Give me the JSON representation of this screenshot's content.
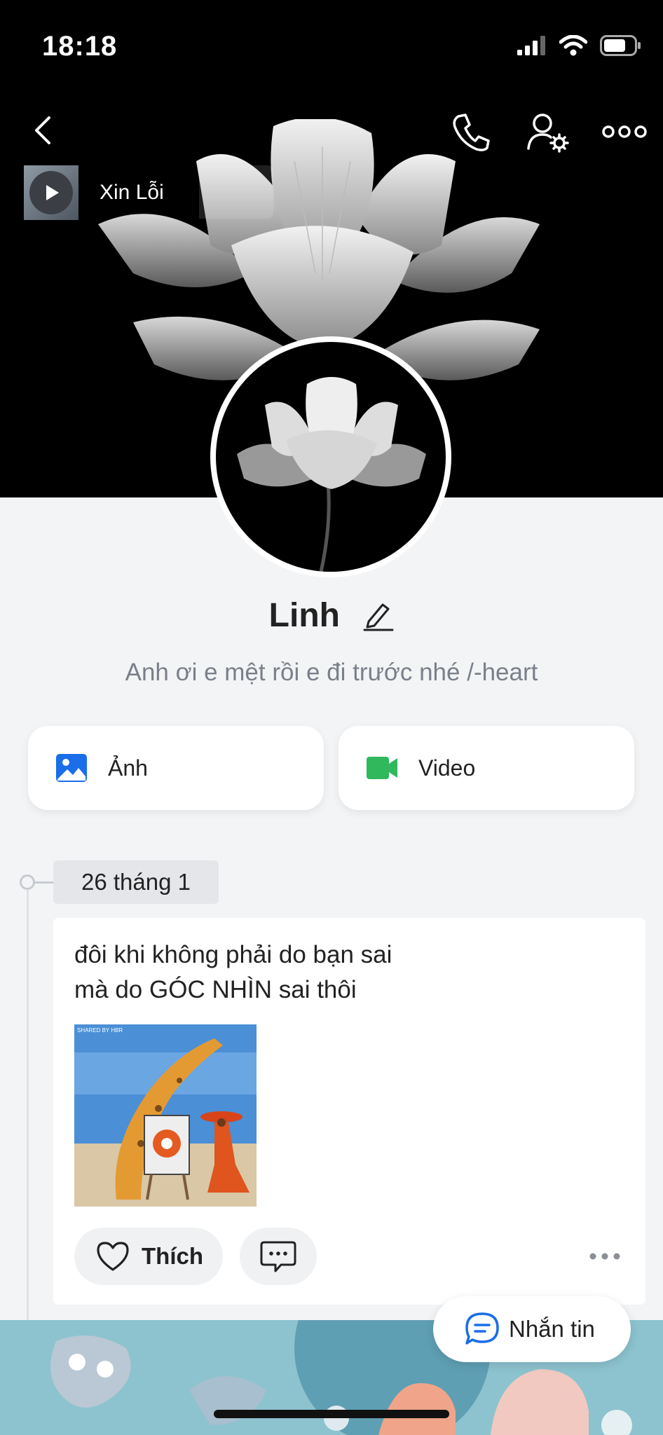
{
  "status_bar": {
    "time": "18:18"
  },
  "music": {
    "song_title": "Xin Lỗi"
  },
  "profile": {
    "name": "Linh",
    "bio": "Anh ơi e mệt rồi e đi trước nhé  /-heart"
  },
  "media_buttons": {
    "photo_label": "Ảnh",
    "video_label": "Video"
  },
  "timeline": {
    "date": "26 tháng 1",
    "post": {
      "line1": "đôi khi không phải do bạn sai",
      "line2": "mà do GÓC NHÌN sai thôi",
      "image_caption": "SHARED BY HBR",
      "like_label": "Thích"
    }
  },
  "message_button": {
    "label": "Nhắn tin"
  },
  "colors": {
    "accent_blue": "#1a6ee8",
    "video_green": "#2fb85c",
    "background": "#f3f4f6"
  }
}
